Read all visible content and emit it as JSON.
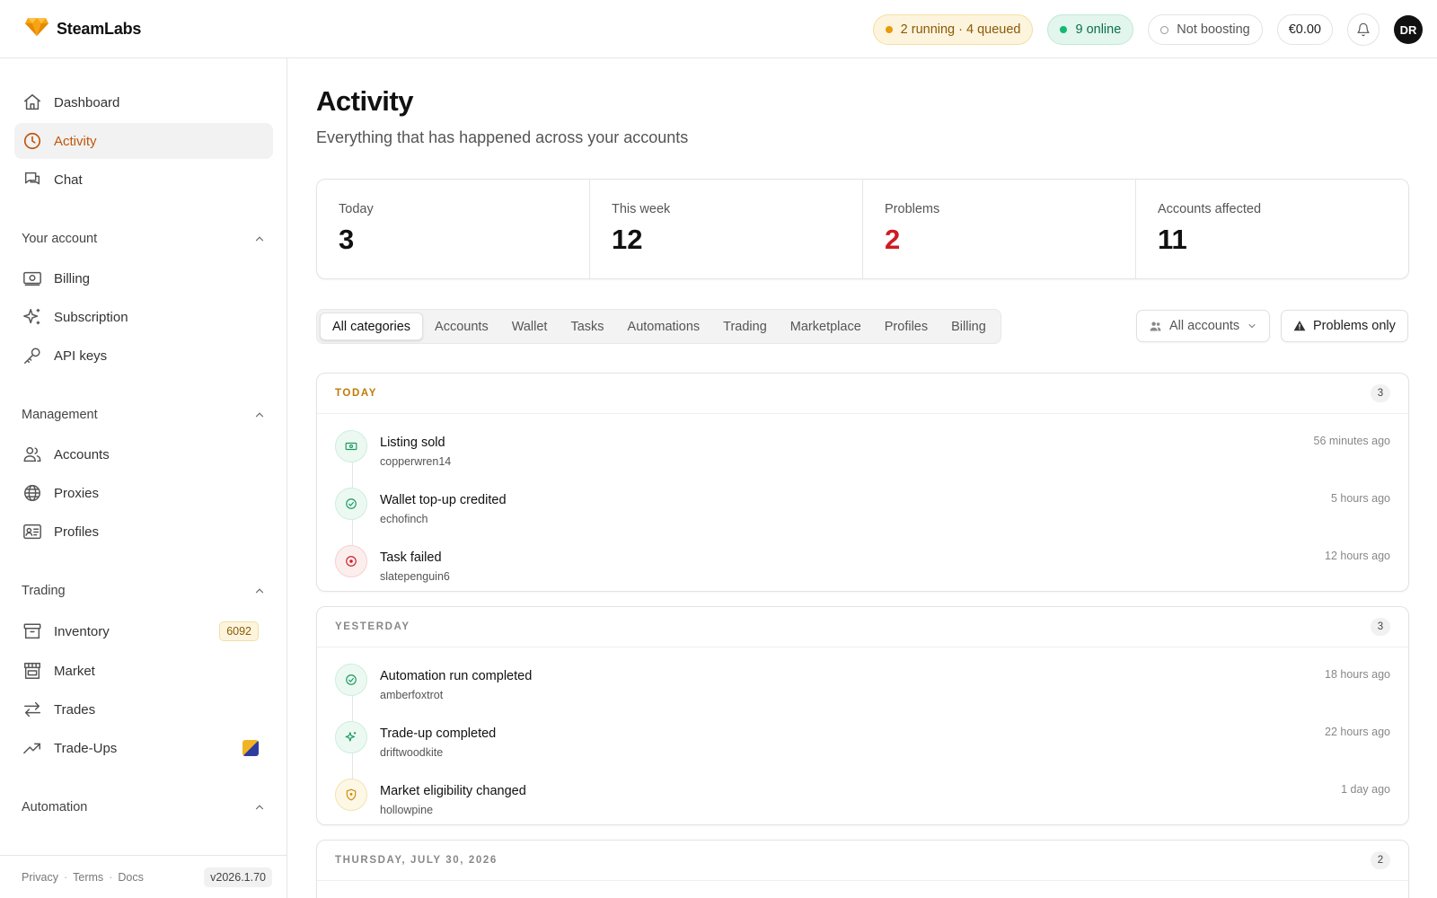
{
  "brand": {
    "name": "SteamLabs"
  },
  "topbar": {
    "running": "2 running · 4 queued",
    "online": "9 online",
    "boost": "Not boosting",
    "balance": "€0.00",
    "avatar": "DR"
  },
  "sidebar": {
    "top_items": [
      {
        "label": "Dashboard",
        "icon": "home-icon"
      },
      {
        "label": "Activity",
        "icon": "clock-icon",
        "active": true
      },
      {
        "label": "Chat",
        "icon": "chat-icon"
      }
    ],
    "sections": [
      {
        "title": "Your account",
        "items": [
          {
            "label": "Billing",
            "icon": "billing-icon"
          },
          {
            "label": "Subscription",
            "icon": "sparkles-icon"
          },
          {
            "label": "API keys",
            "icon": "key-icon"
          }
        ]
      },
      {
        "title": "Management",
        "items": [
          {
            "label": "Accounts",
            "icon": "users-icon"
          },
          {
            "label": "Proxies",
            "icon": "globe-icon"
          },
          {
            "label": "Profiles",
            "icon": "id-card-icon"
          }
        ]
      },
      {
        "title": "Trading",
        "items": [
          {
            "label": "Inventory",
            "icon": "archive-icon",
            "badge": "6092"
          },
          {
            "label": "Market",
            "icon": "store-icon"
          },
          {
            "label": "Trades",
            "icon": "arrows-icon"
          },
          {
            "label": "Trade-Ups",
            "icon": "trending-up-icon"
          }
        ]
      },
      {
        "title": "Automation",
        "items": []
      }
    ],
    "footer": {
      "privacy": "Privacy",
      "terms": "Terms",
      "docs": "Docs",
      "sep": "·",
      "version": "v2026.1.70"
    }
  },
  "page": {
    "title": "Activity",
    "subtitle": "Everything that has happened across your accounts"
  },
  "stats": [
    {
      "label": "Today",
      "value": "3"
    },
    {
      "label": "This week",
      "value": "12"
    },
    {
      "label": "Problems",
      "value": "2",
      "color": "#d01b24"
    },
    {
      "label": "Accounts affected",
      "value": "11"
    }
  ],
  "filters": {
    "tabs": [
      "All categories",
      "Accounts",
      "Wallet",
      "Tasks",
      "Automations",
      "Trading",
      "Marketplace",
      "Profiles",
      "Billing"
    ],
    "active": "All categories",
    "accounts_select": "All accounts",
    "problems_only": "Problems only"
  },
  "groups": [
    {
      "title": "TODAY",
      "count": "3",
      "events": [
        {
          "title": "Listing sold",
          "account": "copperwren14",
          "time": "56 minutes ago",
          "status": "green",
          "icon": "banknote-icon"
        },
        {
          "title": "Wallet top-up credited",
          "account": "echofinch",
          "time": "5 hours ago",
          "status": "green",
          "icon": "check-circle-icon"
        },
        {
          "title": "Task failed",
          "account": "slatepenguin6",
          "time": "12 hours ago",
          "status": "red",
          "icon": "x-circle-icon"
        }
      ]
    },
    {
      "title": "YESTERDAY",
      "count": "3",
      "events": [
        {
          "title": "Automation run completed",
          "account": "amberfoxtrot",
          "time": "18 hours ago",
          "status": "green",
          "icon": "check-circle-icon"
        },
        {
          "title": "Trade-up completed",
          "account": "driftwoodkite",
          "time": "22 hours ago",
          "status": "green",
          "icon": "sparkles-icon"
        },
        {
          "title": "Market eligibility changed",
          "account": "hollowpine",
          "time": "1 day ago",
          "status": "amber",
          "icon": "shield-icon"
        }
      ]
    },
    {
      "title": "THURSDAY, JULY 30, 2026",
      "count": "2",
      "events": []
    }
  ],
  "colors": {
    "accent": "#c0560b",
    "danger": "#d01b24",
    "success": "#14b872",
    "warning": "#e99b0b"
  }
}
